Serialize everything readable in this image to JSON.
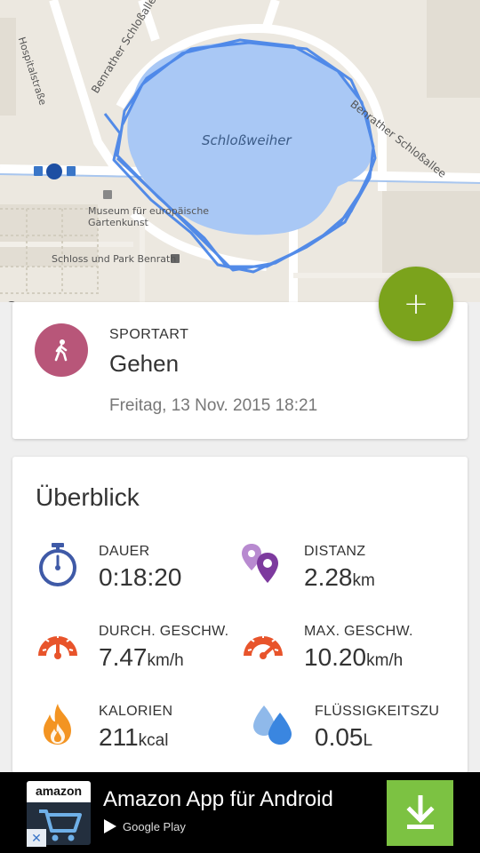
{
  "map": {
    "lake_label": "Schloßweiher",
    "street_left": "Benrather Schloßallee",
    "street_right": "Benrather Schloßallee",
    "street_hospital": "Hospitalstraße",
    "museum_line1": "Museum für europäische",
    "museum_line2": "Gartenkunst",
    "schloss": "Schloss und Park Benrath",
    "google": "gle"
  },
  "fab": {
    "label": "+"
  },
  "sport": {
    "caption": "SPORTART",
    "value": "Gehen",
    "date": "Freitag, 13 Nov. 2015 18:21",
    "icon": "walking-person-icon",
    "color": "#b85679"
  },
  "overview": {
    "title": "Überblick",
    "stats": [
      {
        "label": "DAUER",
        "value": "0:18:20",
        "unit": "",
        "icon": "stopwatch-icon"
      },
      {
        "label": "DISTANZ",
        "value": "2.28",
        "unit": "km",
        "icon": "location-pins-icon"
      },
      {
        "label": "DURCH. GESCHW.",
        "value": "7.47",
        "unit": "km/h",
        "icon": "speedometer-icon"
      },
      {
        "label": "MAX. GESCHW.",
        "value": "10.20",
        "unit": "km/h",
        "icon": "speedometer-max-icon"
      },
      {
        "label": "KALORIEN",
        "value": "211",
        "unit": "kcal",
        "icon": "flame-icon"
      },
      {
        "label": "FLÜSSIGKEITSZU",
        "value": "0.05",
        "unit": "L",
        "icon": "water-drops-icon"
      }
    ]
  },
  "ad": {
    "brand": "amazon",
    "title": "Amazon App für Android",
    "store": "Google Play",
    "close": "✕",
    "download_color": "#7cc242"
  },
  "colors": {
    "fab": "#7ba31c",
    "route": "#4a86e8",
    "lake": "#a9c8f5"
  }
}
